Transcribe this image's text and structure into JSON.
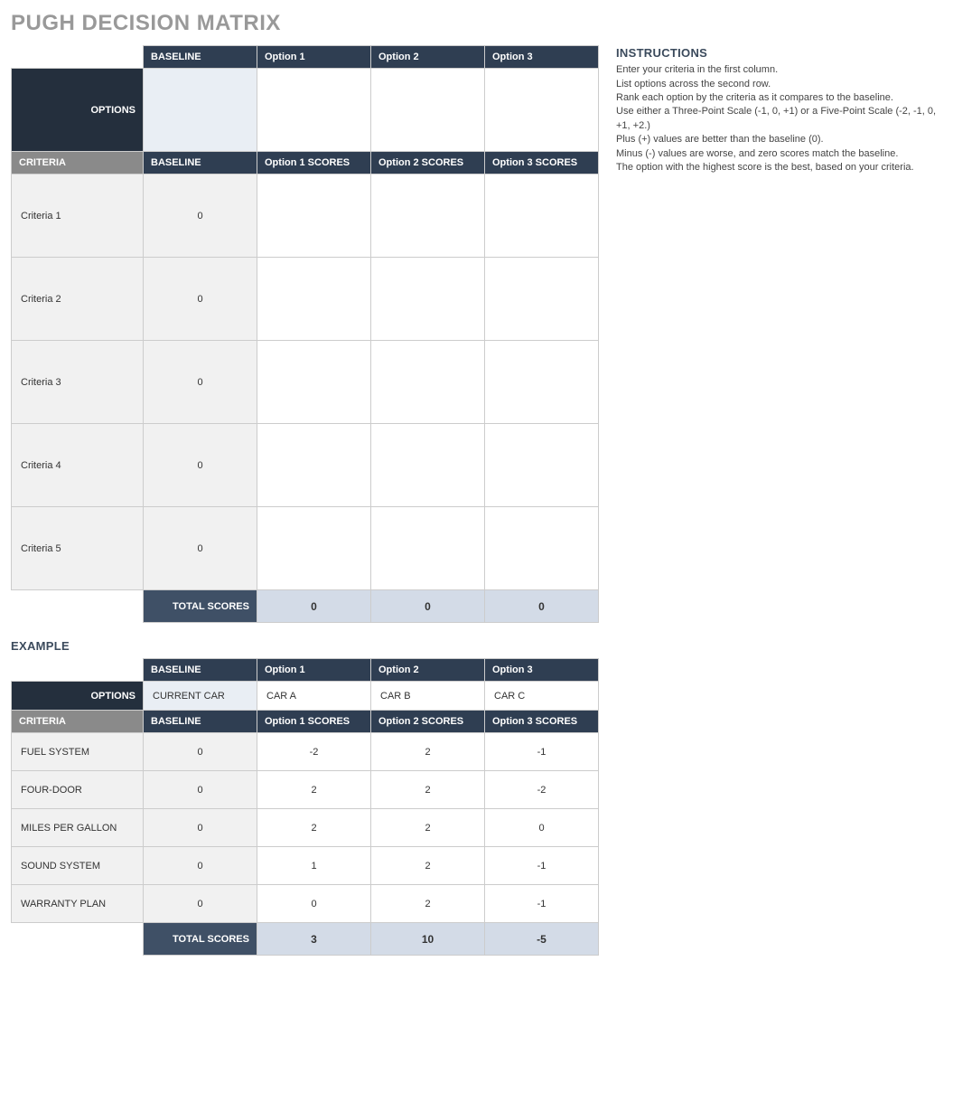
{
  "title": "PUGH DECISION MATRIX",
  "labels": {
    "options": "OPTIONS",
    "criteria": "CRITERIA",
    "baseline": "BASELINE",
    "total_scores": "TOTAL SCORES",
    "example": "EXAMPLE"
  },
  "option_headers": [
    "Option 1",
    "Option 2",
    "Option 3"
  ],
  "score_headers": [
    "Option 1 SCORES",
    "Option 2 SCORES",
    "Option 3 SCORES"
  ],
  "main": {
    "option_values": {
      "baseline": "",
      "options": [
        "",
        "",
        ""
      ]
    },
    "criteria": [
      {
        "name": "Criteria 1",
        "baseline": "0",
        "scores": [
          "",
          "",
          ""
        ]
      },
      {
        "name": "Criteria 2",
        "baseline": "0",
        "scores": [
          "",
          "",
          ""
        ]
      },
      {
        "name": "Criteria 3",
        "baseline": "0",
        "scores": [
          "",
          "",
          ""
        ]
      },
      {
        "name": "Criteria 4",
        "baseline": "0",
        "scores": [
          "",
          "",
          ""
        ]
      },
      {
        "name": "Criteria 5",
        "baseline": "0",
        "scores": [
          "",
          "",
          ""
        ]
      }
    ],
    "totals": [
      "0",
      "0",
      "0"
    ]
  },
  "example": {
    "option_values": {
      "baseline": "CURRENT CAR",
      "options": [
        "CAR A",
        "CAR B",
        "CAR C"
      ]
    },
    "criteria": [
      {
        "name": "FUEL SYSTEM",
        "baseline": "0",
        "scores": [
          "-2",
          "2",
          "-1"
        ]
      },
      {
        "name": "FOUR-DOOR",
        "baseline": "0",
        "scores": [
          "2",
          "2",
          "-2"
        ]
      },
      {
        "name": "MILES PER GALLON",
        "baseline": "0",
        "scores": [
          "2",
          "2",
          "0"
        ]
      },
      {
        "name": "SOUND SYSTEM",
        "baseline": "0",
        "scores": [
          "1",
          "2",
          "-1"
        ]
      },
      {
        "name": "WARRANTY PLAN",
        "baseline": "0",
        "scores": [
          "0",
          "2",
          "-1"
        ]
      }
    ],
    "totals": [
      "3",
      "10",
      "-5"
    ]
  },
  "instructions": {
    "heading": "INSTRUCTIONS",
    "lines": [
      "Enter your criteria in the first column.",
      "List options across the second row.",
      "Rank each option by the criteria as it compares to the baseline.",
      "Use either a Three-Point Scale (-1, 0, +1) or a Five-Point Scale (-2, -1, 0, +1, +2.)",
      "Plus (+) values are better than the baseline (0).",
      "Minus (-) values are worse, and zero scores match the baseline.",
      "The option with the highest score is the best, based on your criteria."
    ]
  }
}
